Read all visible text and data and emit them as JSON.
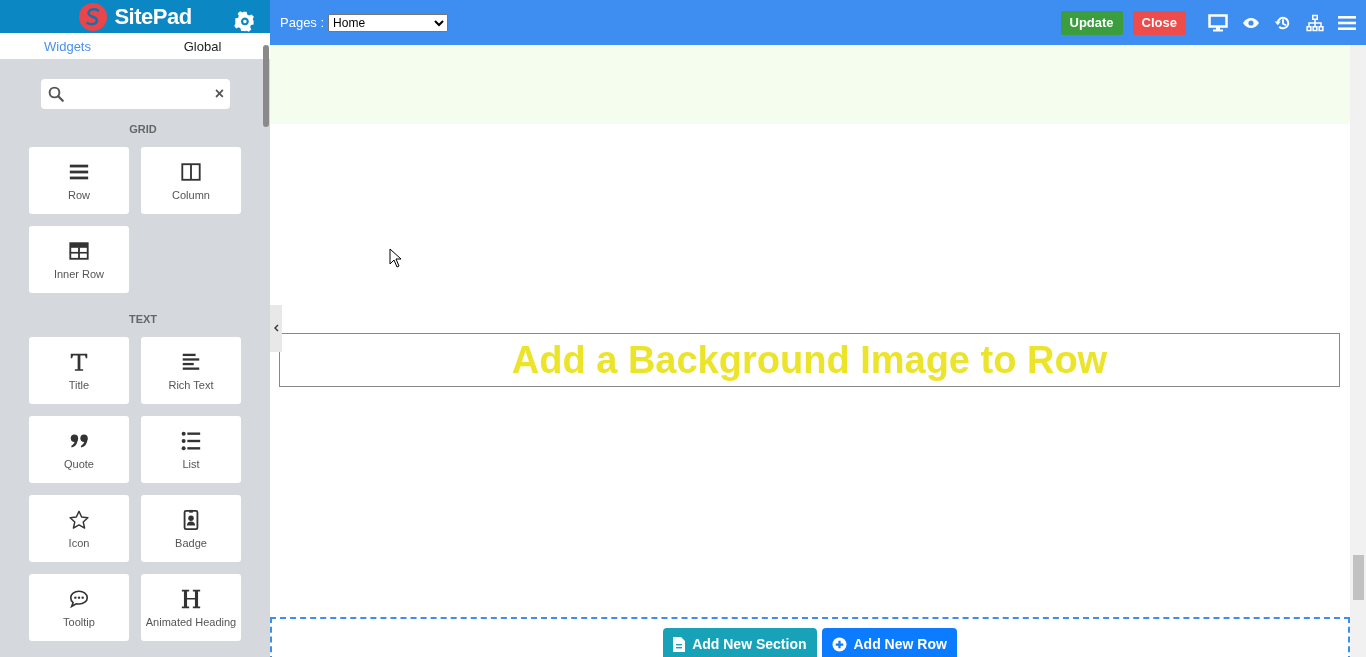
{
  "brand": {
    "name": "SitePad"
  },
  "tabs": [
    {
      "label": "Widgets",
      "selected": true
    },
    {
      "label": "Global",
      "selected": false
    }
  ],
  "search": {
    "clear": "×"
  },
  "groups": [
    {
      "title": "GRID",
      "widgets": [
        {
          "label": "Row"
        },
        {
          "label": "Column"
        },
        {
          "label": "Inner Row"
        }
      ]
    },
    {
      "title": "TEXT",
      "widgets": [
        {
          "label": "Title"
        },
        {
          "label": "Rich Text"
        },
        {
          "label": "Quote"
        },
        {
          "label": "List"
        },
        {
          "label": "Icon"
        },
        {
          "label": "Badge"
        },
        {
          "label": "Tooltip"
        },
        {
          "label": "Animated Heading"
        }
      ]
    }
  ],
  "toolbar": {
    "pages_label": "Pages :",
    "page": "Home",
    "update": "Update",
    "close": "Close"
  },
  "canvas": {
    "row_heading": "Add a Background Image to Row",
    "add_section": "Add New Section",
    "add_row": "Add New Row"
  }
}
